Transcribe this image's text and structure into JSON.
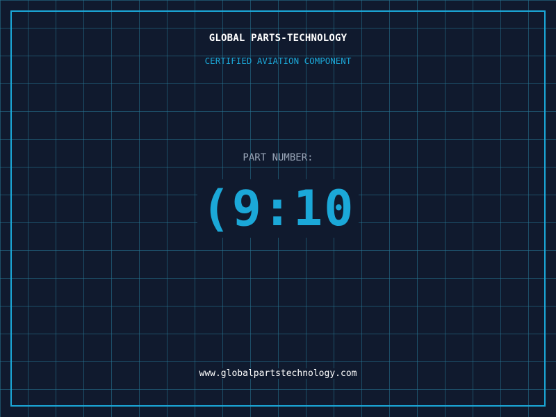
{
  "label": {
    "company": "GLOBAL PARTS-TECHNOLOGY",
    "tagline": "CERTIFIED AVIATION COMPONENT",
    "part_number_label": "PART NUMBER:",
    "part_number_value": "(9:10",
    "website": "www.globalpartstechnology.com"
  },
  "colors": {
    "background": "#101a2e",
    "grid": "#287896",
    "accent": "#1ba8d8",
    "text": "#ffffff",
    "muted": "#9aa6b8"
  }
}
